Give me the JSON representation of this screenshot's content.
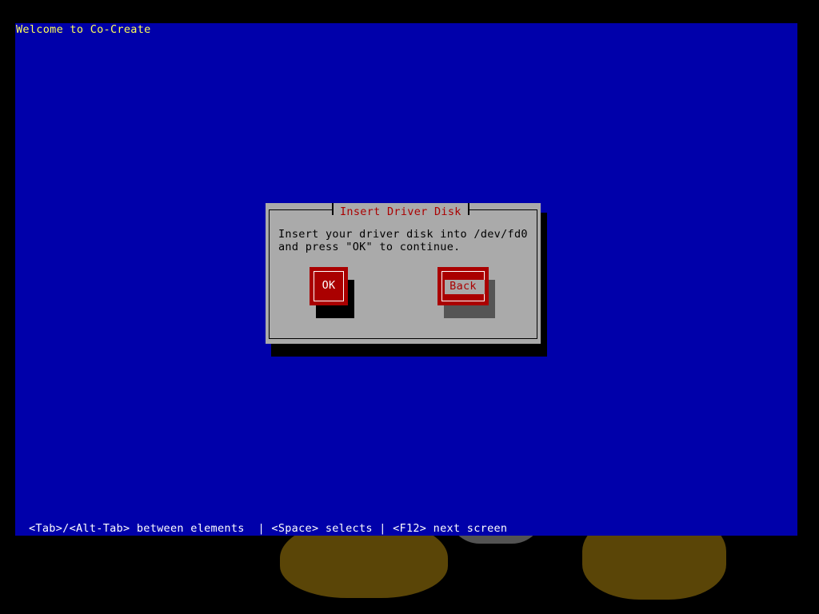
{
  "screen": {
    "title": "Welcome to Co-Create",
    "help_line": "<Tab>/<Alt-Tab> between elements  | <Space> selects | <F12> next screen"
  },
  "dialog": {
    "title": "Insert Driver Disk",
    "message_line1": "Insert your driver disk into /dev/fd0",
    "message_line2": "and press \"OK\" to continue.",
    "buttons": {
      "ok_label": "OK",
      "back_label": "Back"
    },
    "focused_button": "Back"
  },
  "colors": {
    "screen_background": "#0000aa",
    "dialog_background": "#aaaaaa",
    "accent_red": "#aa0000",
    "title_yellow": "#ffff55"
  }
}
